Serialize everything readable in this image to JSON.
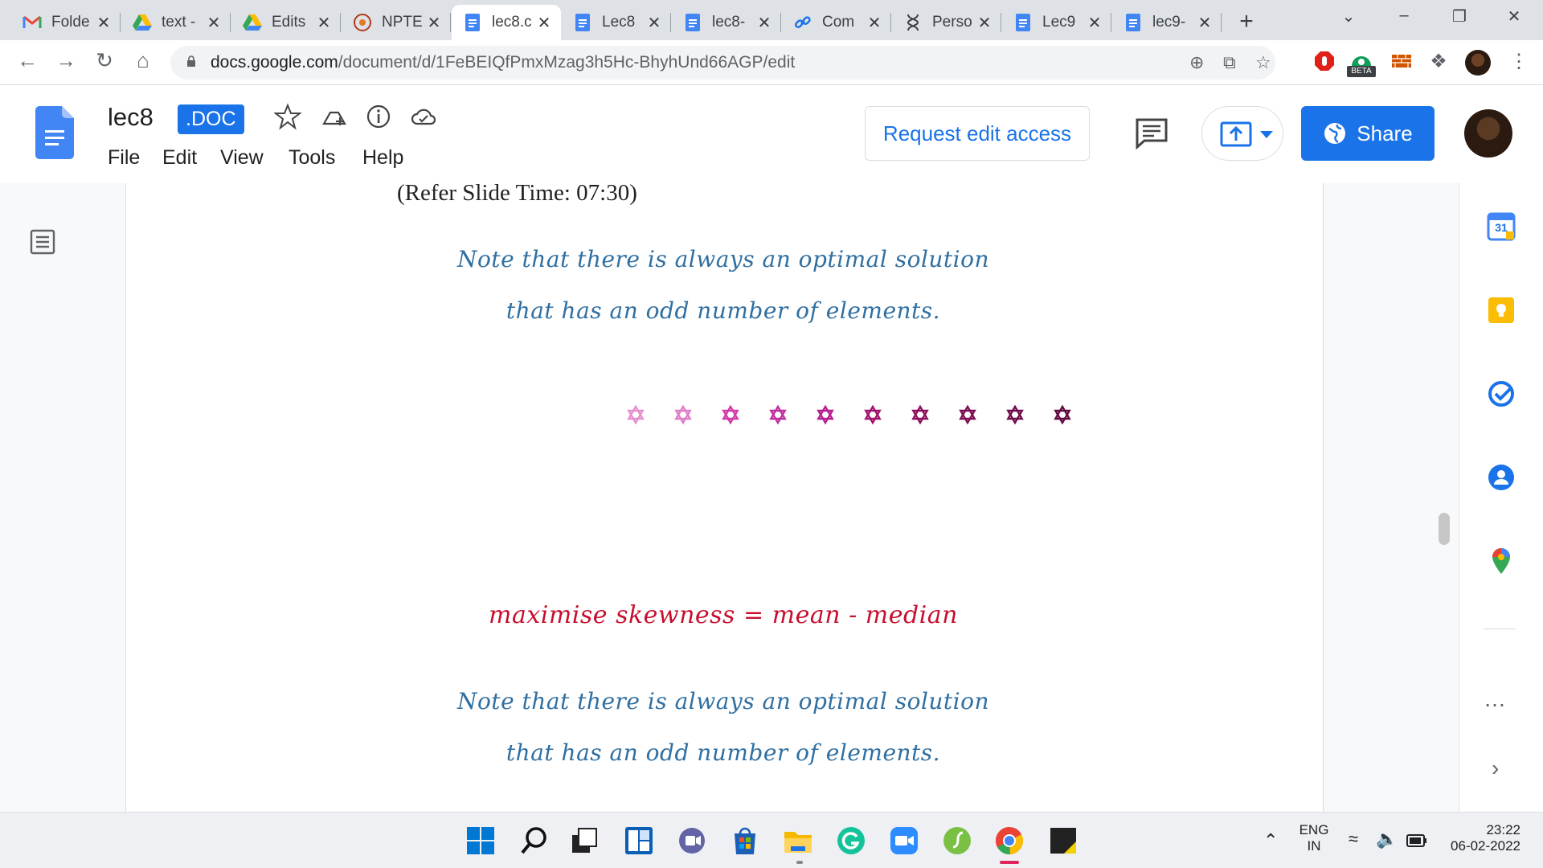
{
  "browser": {
    "tabs": [
      {
        "title": "Folde",
        "icon": "gmail-icon"
      },
      {
        "title": "text -",
        "icon": "google-drive-icon"
      },
      {
        "title": "Edits",
        "icon": "google-drive-icon"
      },
      {
        "title": "NPTE",
        "icon": "nptel-icon"
      },
      {
        "title": "lec8.c",
        "icon": "google-docs-icon",
        "active": true
      },
      {
        "title": "Lec8",
        "icon": "google-docs-icon"
      },
      {
        "title": "lec8-",
        "icon": "google-docs-icon"
      },
      {
        "title": "Com",
        "icon": "link-icon"
      },
      {
        "title": "Perso",
        "icon": "dna-icon"
      },
      {
        "title": "Lec9",
        "icon": "google-docs-icon"
      },
      {
        "title": "lec9-",
        "icon": "google-docs-icon"
      }
    ],
    "url_host": "docs.google.com",
    "url_path": "/document/d/1FeBEIQfPmxMzag3h5Hc-BhyhUnd66AGP/edit",
    "extension_badge": "BETA"
  },
  "doc": {
    "name": "lec8",
    "badge": ".DOC",
    "menu": [
      "File",
      "Edit",
      "View",
      "Tools",
      "Help"
    ],
    "request_edit": "Request edit access",
    "share": "Share"
  },
  "content": {
    "refer": "(Refer Slide Time: 07:30)",
    "note_line1": "Note that there is always an optimal solution",
    "note_line2": "that has an odd number of elements.",
    "formula": "maximise skewness = mean - median",
    "note2_line1": "Note that there is always an optimal solution",
    "note2_line2": "that has an odd number of elements.",
    "star_colors": [
      "#e58fd0",
      "#e07cc8",
      "#cf3aa8",
      "#c02d9e",
      "#b51c8e",
      "#a0126e",
      "#8c0f5c",
      "#7c0d52",
      "#6e0b49",
      "#610a42"
    ]
  },
  "sidepanel": {
    "calendar_day": "31"
  },
  "taskbar": {
    "lang_top": "ENG",
    "lang_bottom": "IN",
    "time": "23:22",
    "date": "06-02-2022"
  },
  "colors": {
    "accent": "#1a73e8",
    "handwriting_blue": "#2f6fa1",
    "handwriting_red": "#c8102e"
  }
}
